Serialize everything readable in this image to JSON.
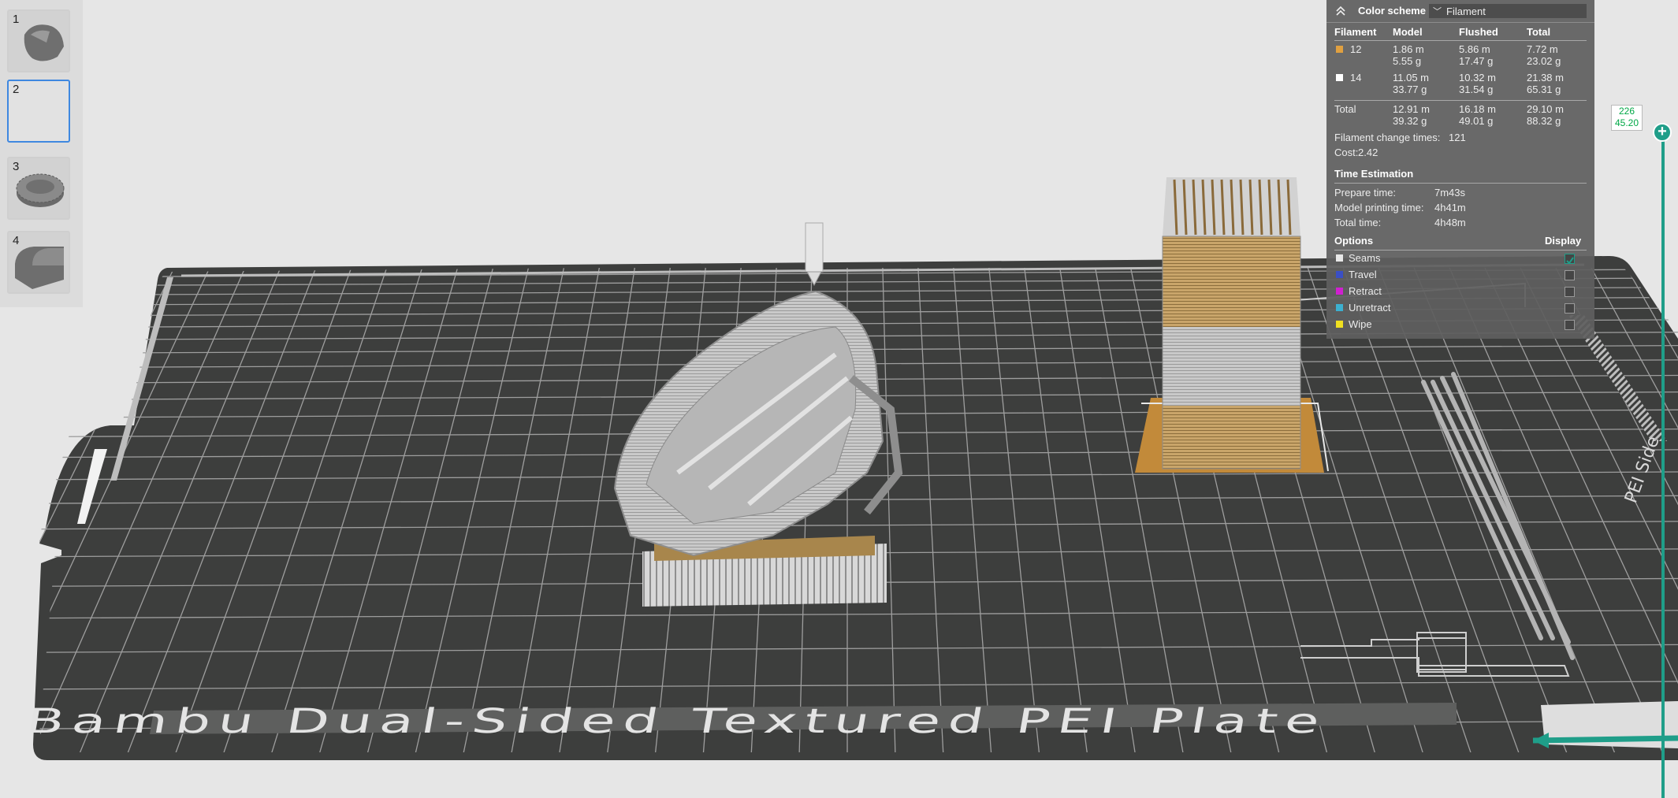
{
  "plates": [
    {
      "number": "1",
      "selected": false
    },
    {
      "number": "2",
      "selected": true
    },
    {
      "number": "3",
      "selected": false
    },
    {
      "number": "4",
      "selected": false
    }
  ],
  "legend": {
    "color_scheme_label": "Color scheme",
    "color_scheme_value": "Filament",
    "headers": {
      "filament": "Filament",
      "model": "Model",
      "flushed": "Flushed",
      "total": "Total"
    },
    "filaments": [
      {
        "name": "12",
        "color": "#e0a040",
        "model_m": "1.86 m",
        "model_g": "5.55 g",
        "flushed_m": "5.86 m",
        "flushed_g": "17.47 g",
        "total_m": "7.72 m",
        "total_g": "23.02 g"
      },
      {
        "name": "14",
        "color": "#ffffff",
        "model_m": "11.05 m",
        "model_g": "33.77 g",
        "flushed_m": "10.32 m",
        "flushed_g": "31.54 g",
        "total_m": "21.38 m",
        "total_g": "65.31 g"
      }
    ],
    "total_row": {
      "label": "Total",
      "model_m": "12.91 m",
      "model_g": "39.32 g",
      "flushed_m": "16.18 m",
      "flushed_g": "49.01 g",
      "total_m": "29.10 m",
      "total_g": "88.32 g"
    },
    "filament_change_label": "Filament change times:",
    "filament_change_value": "121",
    "cost_label": "Cost:",
    "cost_value": "2.42",
    "time_section": "Time Estimation",
    "prepare_label": "Prepare time:",
    "prepare_value": "7m43s",
    "model_time_label": "Model printing time:",
    "model_time_value": "4h41m",
    "total_time_label": "Total time:",
    "total_time_value": "4h48m",
    "options_label": "Options",
    "display_label": "Display",
    "options": [
      {
        "name": "Seams",
        "color": "#e8e8e8",
        "checked": true
      },
      {
        "name": "Travel",
        "color": "#3a4fc4",
        "checked": false
      },
      {
        "name": "Retract",
        "color": "#d020d0",
        "checked": false
      },
      {
        "name": "Unretract",
        "color": "#3cb0d0",
        "checked": false
      },
      {
        "name": "Wipe",
        "color": "#f0e020",
        "checked": false
      }
    ]
  },
  "layer_slider": {
    "layer": "226",
    "height": "45.20"
  },
  "plate_label": "Bambu Dual-Sided Textured PEI Plate",
  "colors": {
    "accent": "#1f9e89",
    "selection": "#3f88e0",
    "filament_12": "#e0a040",
    "filament_14": "#ffffff"
  }
}
